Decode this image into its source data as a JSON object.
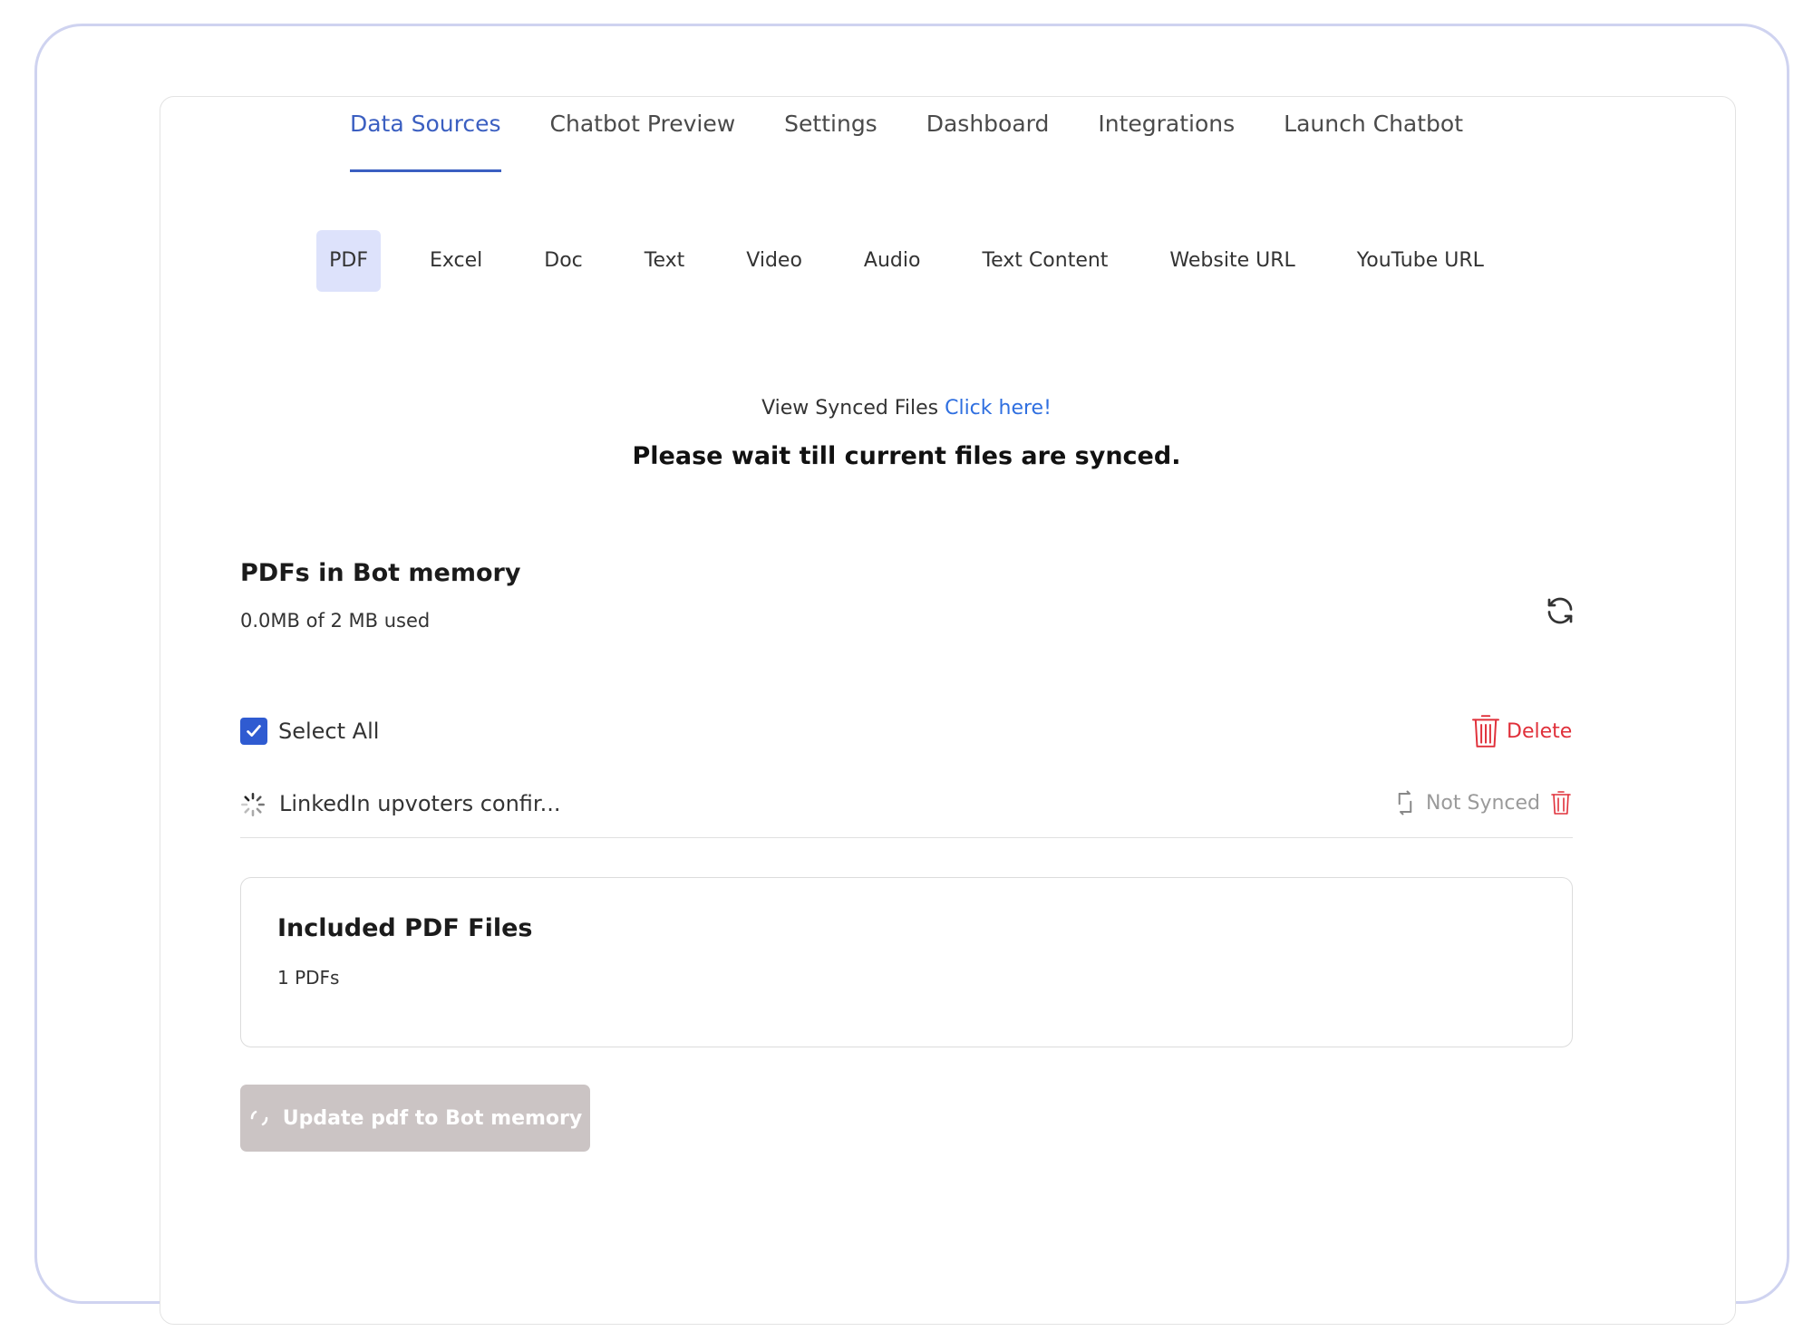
{
  "top_tabs": [
    {
      "label": "Data Sources",
      "active": true
    },
    {
      "label": "Chatbot Preview",
      "active": false
    },
    {
      "label": "Settings",
      "active": false
    },
    {
      "label": "Dashboard",
      "active": false
    },
    {
      "label": "Integrations",
      "active": false
    },
    {
      "label": "Launch Chatbot",
      "active": false
    }
  ],
  "sub_tabs": [
    {
      "label": "PDF",
      "active": true
    },
    {
      "label": "Excel",
      "active": false
    },
    {
      "label": "Doc",
      "active": false
    },
    {
      "label": "Text",
      "active": false
    },
    {
      "label": "Video",
      "active": false
    },
    {
      "label": "Audio",
      "active": false
    },
    {
      "label": "Text Content",
      "active": false
    },
    {
      "label": "Website URL",
      "active": false
    },
    {
      "label": "YouTube URL",
      "active": false
    }
  ],
  "synced": {
    "prefix": "View Synced Files",
    "link": "Click here!"
  },
  "wait_message": "Please wait till current files are synced.",
  "memory": {
    "title": "PDFs in Bot memory",
    "usage": "0.0MB of 2 MB used"
  },
  "select_all": {
    "label": "Select All",
    "checked": true
  },
  "delete_label": "Delete",
  "files": [
    {
      "name": "LinkedIn upvoters confir...",
      "status": "Not Synced"
    }
  ],
  "included": {
    "title": "Included PDF Files",
    "count": "1 PDFs"
  },
  "update_button": "Update pdf to Bot memory",
  "colors": {
    "accent": "#3b5fc1",
    "link": "#2f6fe0",
    "danger": "#e0303a",
    "active_subtab_bg": "#dde2fb",
    "disabled_button": "#cbc4c4",
    "frame_border": "#cfd3f0"
  },
  "icons": {
    "refresh": "refresh-icon",
    "checkbox": "checkmark-icon",
    "delete": "trash-icon",
    "loading": "spinner-icon",
    "sync": "sync-icon"
  }
}
